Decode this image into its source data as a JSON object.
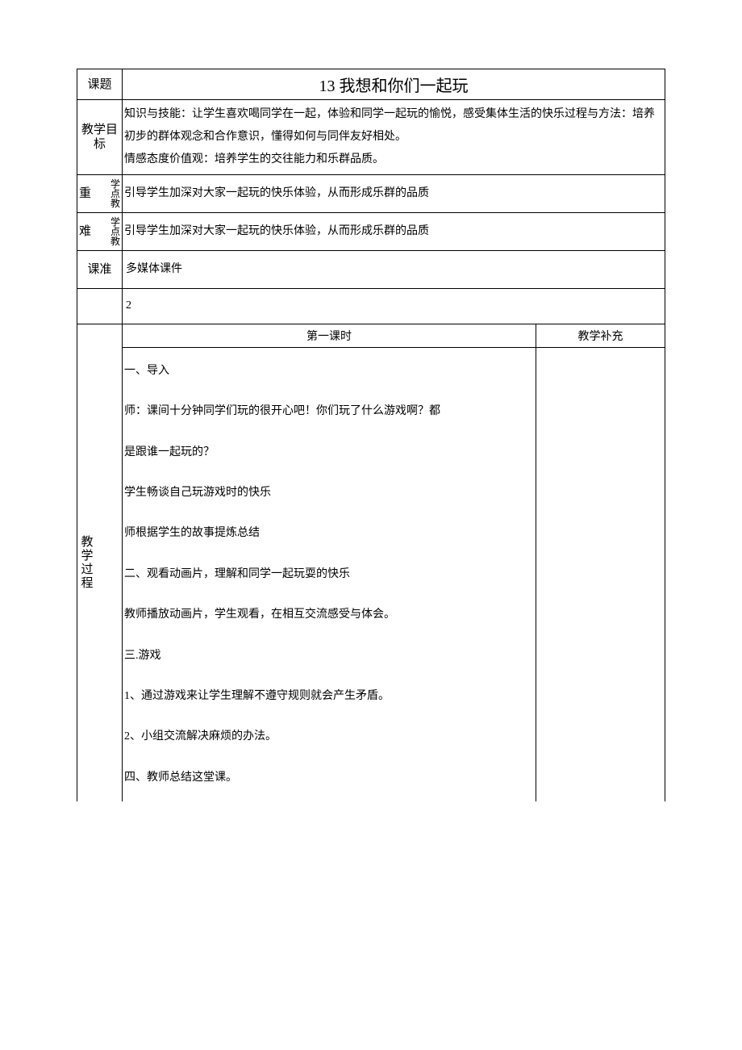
{
  "labels": {
    "topic": "课题",
    "goal": "教学目\n标",
    "importantLeft": "重",
    "importantRight": "学点教",
    "difficultLeft": "难",
    "difficultRight": "学点教",
    "prep": "课准",
    "supplement": "教学补充",
    "lesson1": "第一课时",
    "process": "教学过程"
  },
  "title": "13 我想和你们一起玩",
  "goal_text": "知识与技能：让学生喜欢喝同学在一起，体验和同学一起玩的愉悦，感受集体生活的快乐过程与方法：培养初步的群体观念和合作意识，懂得如何与同伴友好相处。\n情感态度价值观：培养学生的交往能力和乐群品质。",
  "important": "引导学生加深对大家一起玩的快乐体验，从而形成乐群的品质",
  "difficult": "引导学生加深对大家一起玩的快乐体验，从而形成乐群的品质",
  "prep": "多媒体课件",
  "periods": "2",
  "process": {
    "p1": "一、导入",
    "p2": "师：课间十分钟同学们玩的很开心吧！你们玩了什么游戏啊？都",
    "p3": "是跟谁一起玩的？",
    "p4": "学生畅谈自己玩游戏时的快乐",
    "p5": "师根据学生的故事提炼总结",
    "p6": "二、观看动画片，理解和同学一起玩耍的快乐",
    "p7": "教师播放动画片，学生观看，在相互交流感受与体会。",
    "p8": "三.游戏",
    "p9": "1、通过游戏来让学生理解不遵守规则就会产生矛盾。",
    "p10": "2、小组交流解决麻烦的办法。",
    "p11": "四、教师总结这堂课。"
  }
}
